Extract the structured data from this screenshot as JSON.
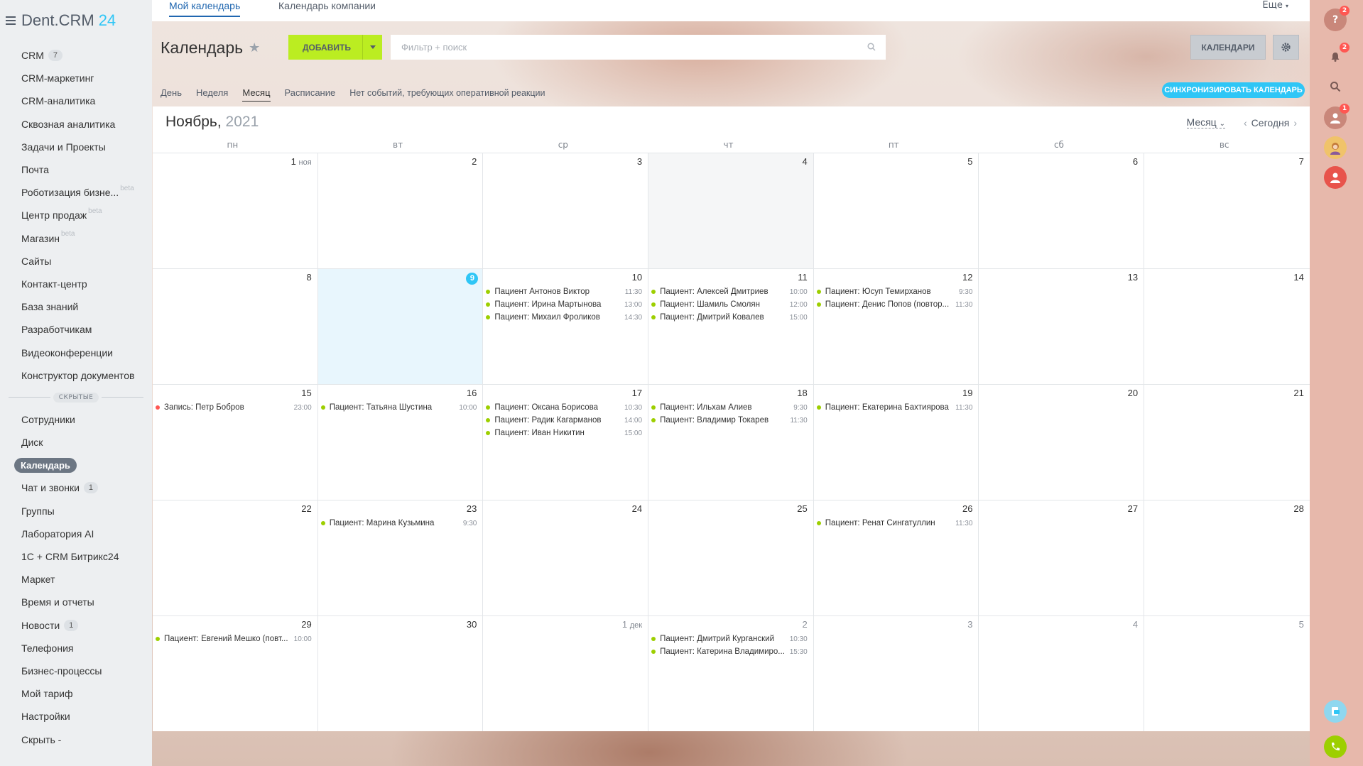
{
  "app": {
    "logo_text": "Dent.CRM",
    "logo_num": "24"
  },
  "sidebar": {
    "items": [
      {
        "label": "CRM",
        "counter": "7"
      },
      {
        "label": "CRM-маркетинг"
      },
      {
        "label": "CRM-аналитика"
      },
      {
        "label": "Сквозная аналитика"
      },
      {
        "label": "Задачи и Проекты"
      },
      {
        "label": "Почта"
      },
      {
        "label": "Роботизация бизне...",
        "beta": "beta"
      },
      {
        "label": "Центр продаж",
        "beta": "beta"
      },
      {
        "label": "Магазин",
        "beta": "beta"
      },
      {
        "label": "Сайты"
      },
      {
        "label": "Контакт-центр"
      },
      {
        "label": "База знаний"
      },
      {
        "label": "Разработчикам"
      },
      {
        "label": "Видеоконференции"
      },
      {
        "label": "Конструктор документов"
      }
    ],
    "hidden_label": "СКРЫТЫЕ",
    "hidden_items": [
      {
        "label": "Сотрудники"
      },
      {
        "label": "Диск"
      },
      {
        "label": "Календарь",
        "active": true
      },
      {
        "label": "Чат и звонки",
        "counter": "1"
      },
      {
        "label": "Группы"
      },
      {
        "label": "Лаборатория AI"
      },
      {
        "label": "1С + CRM Битрикс24"
      },
      {
        "label": "Маркет"
      },
      {
        "label": "Время и отчеты"
      },
      {
        "label": "Новости",
        "counter": "1"
      },
      {
        "label": "Телефония"
      },
      {
        "label": "Бизнес-процессы"
      },
      {
        "label": "Мой тариф"
      },
      {
        "label": "Настройки"
      },
      {
        "label": "Скрыть -"
      }
    ]
  },
  "topbar": {
    "tabs": [
      "Мой календарь",
      "Календарь компании"
    ],
    "more": "Еще"
  },
  "header": {
    "title": "Календарь",
    "add_label": "ДОБАВИТЬ",
    "search_placeholder": "Фильтр + поиск",
    "calendars_label": "КАЛЕНДАРИ"
  },
  "views": {
    "items": [
      "День",
      "Неделя",
      "Месяц",
      "Расписание"
    ],
    "active": "Месяц",
    "note": "Нет событий, требующих оперативной реакции",
    "sync_label": "СИНХРОНИЗИРОВАТЬ КАЛЕНДАРЬ"
  },
  "calendar": {
    "month": "Ноябрь,",
    "year": "2021",
    "view_select": "Месяц",
    "today_label": "Сегодня",
    "weekdays": [
      "пн",
      "вт",
      "ср",
      "чт",
      "пт",
      "сб",
      "вс"
    ],
    "weeks": [
      [
        {
          "num": "1",
          "suffix": "ноя",
          "events": []
        },
        {
          "num": "2",
          "events": []
        },
        {
          "num": "3",
          "events": []
        },
        {
          "num": "4",
          "shaded": true,
          "events": []
        },
        {
          "num": "5",
          "events": []
        },
        {
          "num": "6",
          "events": []
        },
        {
          "num": "7",
          "events": []
        }
      ],
      [
        {
          "num": "8",
          "events": []
        },
        {
          "num": "9",
          "today": true,
          "events": []
        },
        {
          "num": "10",
          "events": [
            {
              "title": "Пациент Антонов Виктор",
              "time": "11:30"
            },
            {
              "title": "Пациент: Ирина Мартынова",
              "time": "13:00"
            },
            {
              "title": "Пациент: Михаил Фроликов",
              "time": "14:30"
            }
          ]
        },
        {
          "num": "11",
          "events": [
            {
              "title": "Пациент: Алексей Дмитриев",
              "time": "10:00"
            },
            {
              "title": "Пациент: Шамиль Смолян",
              "time": "12:00"
            },
            {
              "title": "Пациент: Дмитрий Ковалев",
              "time": "15:00"
            }
          ]
        },
        {
          "num": "12",
          "events": [
            {
              "title": "Пациент: Юсуп Темирханов",
              "time": "9:30"
            },
            {
              "title": "Пациент: Денис Попов (повтор...",
              "time": "11:30"
            }
          ]
        },
        {
          "num": "13",
          "events": []
        },
        {
          "num": "14",
          "events": []
        }
      ],
      [
        {
          "num": "15",
          "events": [
            {
              "title": "Запись: Петр Бобров",
              "time": "23:00",
              "color": "red"
            }
          ]
        },
        {
          "num": "16",
          "events": [
            {
              "title": "Пациент: Татьяна Шустина",
              "time": "10:00"
            }
          ]
        },
        {
          "num": "17",
          "events": [
            {
              "title": "Пациент: Оксана Борисова",
              "time": "10:30"
            },
            {
              "title": "Пациент: Радик Кагарманов",
              "time": "14:00"
            },
            {
              "title": "Пациент: Иван Никитин",
              "time": "15:00"
            }
          ]
        },
        {
          "num": "18",
          "events": [
            {
              "title": "Пациент: Ильхам Алиев",
              "time": "9:30"
            },
            {
              "title": "Пациент: Владимир Токарев",
              "time": "11:30"
            }
          ]
        },
        {
          "num": "19",
          "events": [
            {
              "title": "Пациент: Екатерина Бахтиярова",
              "time": "11:30"
            }
          ]
        },
        {
          "num": "20",
          "events": []
        },
        {
          "num": "21",
          "events": []
        }
      ],
      [
        {
          "num": "22",
          "events": []
        },
        {
          "num": "23",
          "events": [
            {
              "title": "Пациент: Марина Кузьмина",
              "time": "9:30"
            }
          ]
        },
        {
          "num": "24",
          "events": []
        },
        {
          "num": "25",
          "events": []
        },
        {
          "num": "26",
          "events": [
            {
              "title": "Пациент: Ренат Сингатуллин",
              "time": "11:30"
            }
          ]
        },
        {
          "num": "27",
          "events": []
        },
        {
          "num": "28",
          "events": []
        }
      ],
      [
        {
          "num": "29",
          "events": [
            {
              "title": "Пациент: Евгений Мешко (повт...",
              "time": "10:00"
            }
          ]
        },
        {
          "num": "30",
          "events": []
        },
        {
          "num": "1",
          "suffix": "дек",
          "other": true,
          "events": []
        },
        {
          "num": "2",
          "other": true,
          "events": [
            {
              "title": "Пациент: Дмитрий Курганский",
              "time": "10:30"
            },
            {
              "title": "Пациент: Катерина Владимиро...",
              "time": "15:30"
            }
          ]
        },
        {
          "num": "3",
          "other": true,
          "events": []
        },
        {
          "num": "4",
          "other": true,
          "events": []
        },
        {
          "num": "5",
          "other": true,
          "events": []
        }
      ]
    ]
  },
  "rightbar": {
    "help_badge": "2",
    "notify_badge": "2",
    "user_badge": "1"
  },
  "colors": {
    "accent": "#2fc6f6",
    "add_button": "#bbed21",
    "event_dot": "#9dcf00",
    "event_dot_red": "#ff5752",
    "active_tab": "#2067b0"
  }
}
